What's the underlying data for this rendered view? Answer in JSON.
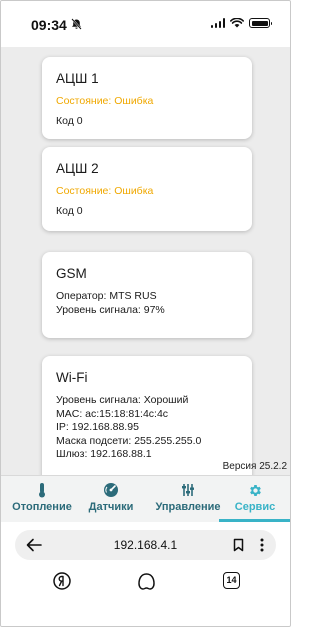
{
  "status_bar": {
    "time": "09:34",
    "icons": [
      "bell-slash-icon",
      "signal-icon",
      "wifi-icon",
      "battery-icon"
    ]
  },
  "cards": [
    {
      "title": "АЦШ 1",
      "state": "Состояние: Ошибка",
      "code": "Код 0"
    },
    {
      "title": "АЦШ 2",
      "state": "Состояние: Ошибка",
      "code": "Код 0"
    },
    {
      "title": "GSM",
      "operator": "Оператор: MTS RUS",
      "signal": "Уровень сигнала: 97%"
    },
    {
      "title": "Wi-Fi",
      "signal": "Уровень сигнала: Хороший",
      "mac": "MAC: ac:15:18:81:4c:4c",
      "ip": "IP: 192.168.88.95",
      "mask": "Маска подсети: 255.255.255.0",
      "gateway": "Шлюз: 192.168.88.1"
    }
  ],
  "version": "Версия 25.2.2",
  "bottom_nav": {
    "items": [
      {
        "label": "Отопление",
        "icon": "thermometer-icon"
      },
      {
        "label": "Датчики",
        "icon": "gauge-icon"
      },
      {
        "label": "Управление",
        "icon": "sliders-icon"
      },
      {
        "label": "Сервис",
        "icon": "gear-icon",
        "active": true
      }
    ]
  },
  "browser": {
    "url": "192.168.4.1",
    "tab_count": "14",
    "icons": [
      "back-arrow-icon",
      "bookmark-icon",
      "more-icon",
      "yandex-icon",
      "alice-icon",
      "tabs-icon"
    ]
  },
  "colors": {
    "error": "#f0a800",
    "nav": "#2c6b7a",
    "nav_active": "#39b3c7",
    "background": "#ececec"
  }
}
